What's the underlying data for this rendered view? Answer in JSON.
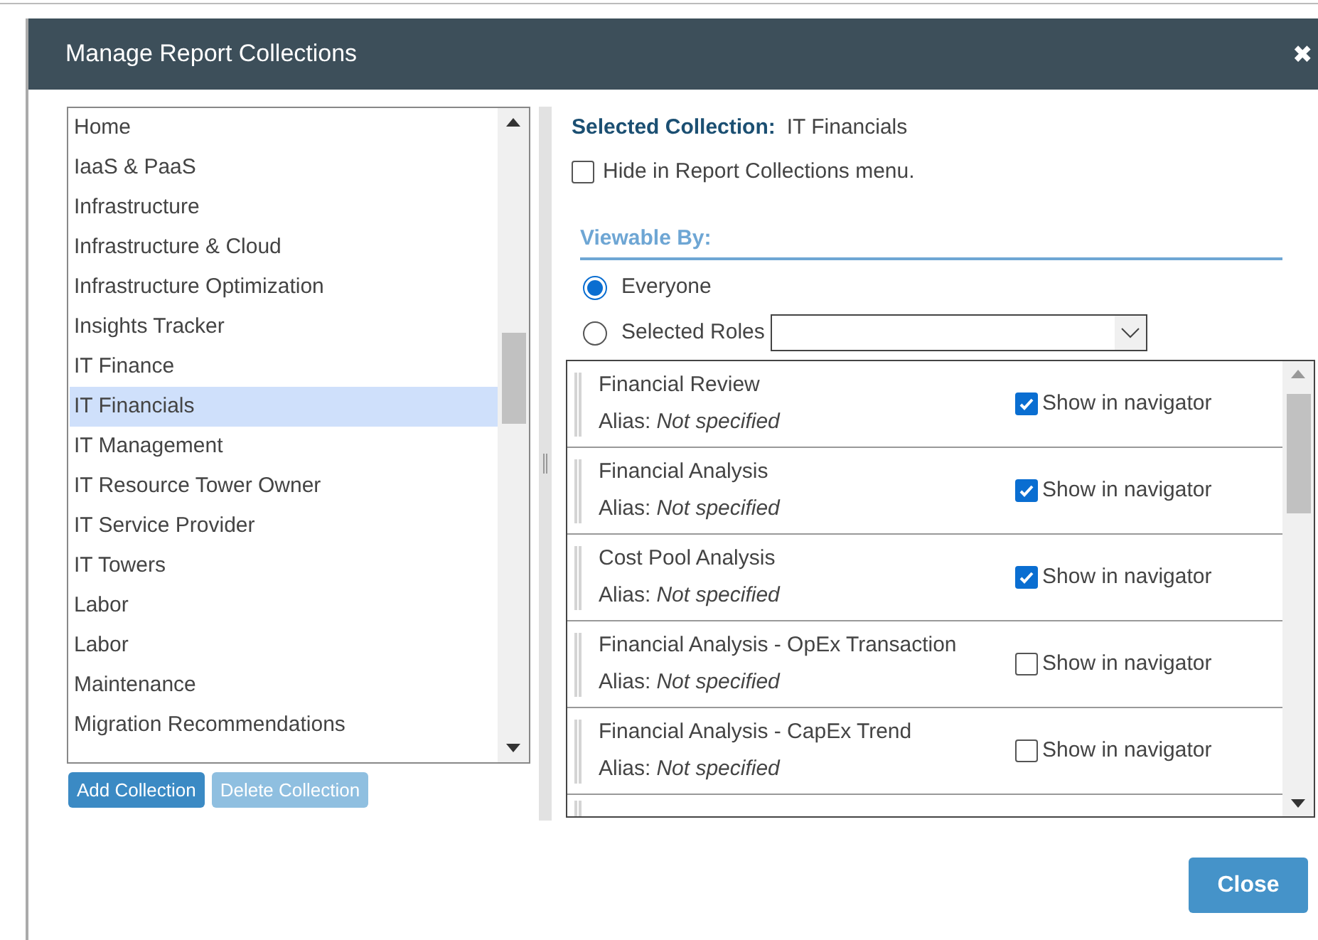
{
  "dialog": {
    "title": "Manage Report Collections",
    "close_icon": "✖"
  },
  "collections": [
    {
      "label": "Home",
      "selected": false
    },
    {
      "label": "IaaS & PaaS",
      "selected": false
    },
    {
      "label": "Infrastructure",
      "selected": false
    },
    {
      "label": "Infrastructure & Cloud",
      "selected": false
    },
    {
      "label": "Infrastructure Optimization",
      "selected": false
    },
    {
      "label": "Insights Tracker",
      "selected": false
    },
    {
      "label": "IT Finance",
      "selected": false
    },
    {
      "label": "IT Financials",
      "selected": true
    },
    {
      "label": "IT Management",
      "selected": false
    },
    {
      "label": "IT Resource Tower Owner",
      "selected": false
    },
    {
      "label": "IT Service Provider",
      "selected": false
    },
    {
      "label": "IT Towers",
      "selected": false
    },
    {
      "label": "Labor",
      "selected": false
    },
    {
      "label": "Labor",
      "selected": false
    },
    {
      "label": "Maintenance",
      "selected": false
    },
    {
      "label": "Migration Recommendations",
      "selected": false
    }
  ],
  "collection_buttons": [
    {
      "label": "Add Collection",
      "disabled": false
    },
    {
      "label": "Delete Collection",
      "disabled": true
    }
  ],
  "selected_collection": {
    "label": "Selected Collection:",
    "value": "IT Financials"
  },
  "hide_in_menu": {
    "label": "Hide in Report Collections menu.",
    "checked": false
  },
  "viewable_by": {
    "heading": "Viewable By:",
    "options": [
      {
        "label": "Everyone",
        "selected": true,
        "kind": "plain"
      },
      {
        "label": "Selected Roles",
        "selected": false,
        "kind": "dropdown"
      }
    ]
  },
  "reports": [
    {
      "name": "Financial Review",
      "alias_label": "Alias:",
      "alias": "Not specified",
      "show_label": "Show in navigator",
      "checked": true
    },
    {
      "name": "Financial Analysis",
      "alias_label": "Alias:",
      "alias": "Not specified",
      "show_label": "Show in navigator",
      "checked": true
    },
    {
      "name": "Cost Pool Analysis",
      "alias_label": "Alias:",
      "alias": "Not specified",
      "show_label": "Show in navigator",
      "checked": true
    },
    {
      "name": "Financial Analysis - OpEx Transaction",
      "alias_label": "Alias:",
      "alias": "Not specified",
      "show_label": "Show in navigator",
      "checked": false
    },
    {
      "name": "Financial Analysis - CapEx Trend",
      "alias_label": "Alias:",
      "alias": "Not specified",
      "show_label": "Show in navigator",
      "checked": false
    }
  ],
  "footer": {
    "close_button": "Close"
  }
}
